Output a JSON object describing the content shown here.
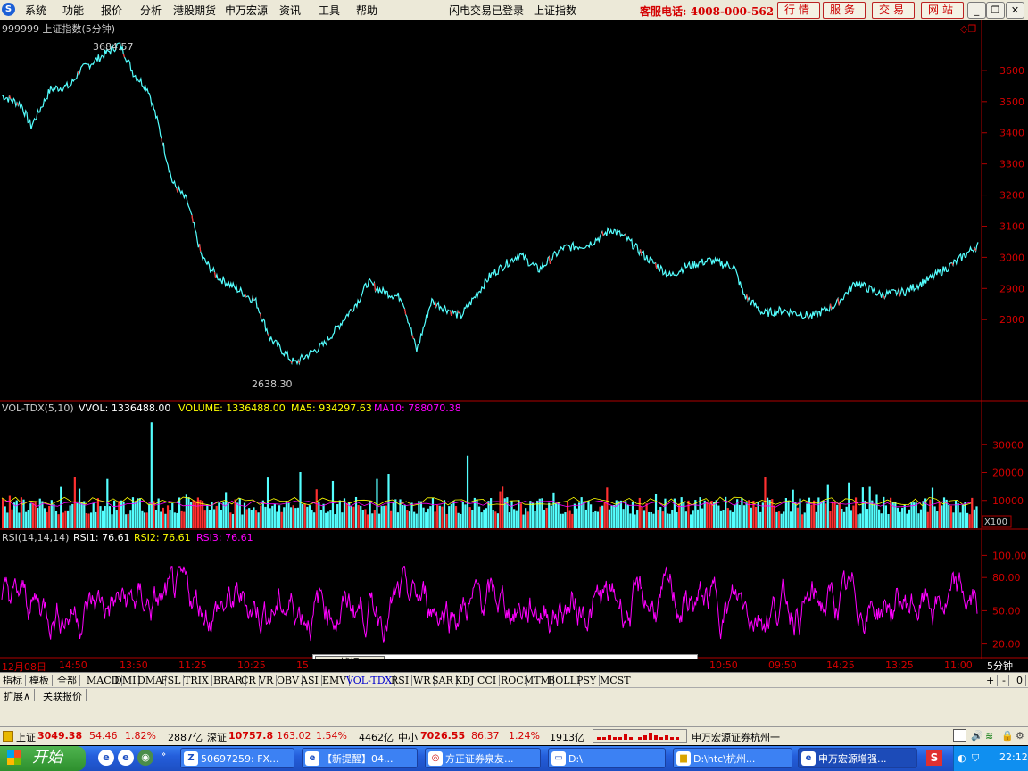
{
  "menubar": {
    "logo": "S",
    "items": [
      "系统",
      "功能",
      "报价",
      "分析",
      "港股期货",
      "申万宏源",
      "资讯",
      "工具",
      "帮助"
    ],
    "login_status": "闪电交易已登录",
    "index_name": "上证指数",
    "hotline": "客服电话: 4008-000-562",
    "tool_buttons": [
      "行情",
      "服务",
      "交易",
      "网站"
    ]
  },
  "chart_data": [
    {
      "type": "line",
      "title": "999999 上证指数(5分钟)",
      "ylim": [
        2560,
        3700
      ],
      "y_ticks": [
        2800,
        2900,
        3000,
        3100,
        3200,
        3300,
        3400,
        3500,
        3600
      ],
      "annotations": [
        {
          "text": "3684.57"
        },
        {
          "text": "2638.30"
        }
      ],
      "series": [
        {
          "name": "上证指数",
          "x_frac": [
            0,
            0.02,
            0.03,
            0.05,
            0.07,
            0.08,
            0.1,
            0.12,
            0.125,
            0.135,
            0.15,
            0.16,
            0.175,
            0.19,
            0.205,
            0.22,
            0.24,
            0.26,
            0.275,
            0.3,
            0.33,
            0.35,
            0.365,
            0.375,
            0.39,
            0.41,
            0.425,
            0.44,
            0.47,
            0.5,
            0.53,
            0.55,
            0.575,
            0.6,
            0.625,
            0.64,
            0.66,
            0.685,
            0.7,
            0.725,
            0.75,
            0.76,
            0.78,
            0.8,
            0.83,
            0.855,
            0.875,
            0.9,
            0.925,
            0.95,
            0.975,
            1.0
          ],
          "values": [
            3520,
            3490,
            3420,
            3540,
            3550,
            3600,
            3640,
            3684,
            3660,
            3590,
            3540,
            3430,
            3240,
            3180,
            3000,
            2940,
            2900,
            2860,
            2740,
            2660,
            2720,
            2800,
            2860,
            2920,
            2890,
            2870,
            2700,
            2860,
            2810,
            2940,
            3010,
            2960,
            3030,
            3040,
            3090,
            3060,
            3000,
            2940,
            2970,
            2990,
            2970,
            2880,
            2820,
            2830,
            2810,
            2850,
            2920,
            2880,
            2890,
            2930,
            2980,
            3040
          ]
        }
      ]
    },
    {
      "type": "bar",
      "title": "VOL-TDX(5,10)",
      "legend": [
        {
          "label": "VVOL: 1336488.00",
          "color": "#ffffff"
        },
        {
          "label": "VOLUME: 1336488.00",
          "color": "#ffff00"
        },
        {
          "label": "MA5: 934297.63",
          "color": "#ffff00"
        },
        {
          "label": "MA10: 788070.38",
          "color": "#ff00ff"
        }
      ],
      "ylim": [
        0,
        40000
      ],
      "y_ticks": [
        10000,
        20000,
        30000
      ],
      "unit": "X100",
      "typical_value": 9000
    },
    {
      "type": "line",
      "title": "RSI(14,14,14)",
      "legend": [
        {
          "label": "RSI1: 76.61",
          "color": "#ffffff"
        },
        {
          "label": "RSI2: 76.61",
          "color": "#ffff00"
        },
        {
          "label": "RSI3: 76.61",
          "color": "#ff00ff"
        }
      ],
      "ylim": [
        10,
        110
      ],
      "y_ticks": [
        "20.00",
        "50.00",
        "80.00",
        "100.00"
      ]
    }
  ],
  "timeaxis": {
    "labels": [
      "12月08日",
      "14:50",
      "13:50",
      "11:25",
      "10:25",
      "15",
      "10:50",
      "09:50",
      "14:25",
      "13:25",
      "11:00"
    ],
    "period": "5分钟"
  },
  "popup_button": "捕捉",
  "indicator_tabs": [
    "指标",
    "模板",
    "全部"
  ],
  "indicators": [
    "MACD",
    "DMI",
    "DMA",
    "FSL",
    "TRIX",
    "BRAR",
    "CR",
    "VR",
    "OBV",
    "ASI",
    "EMV",
    "VOL-TDX",
    "RSI",
    "WR",
    "SAR",
    "KDJ",
    "CCI",
    "ROC",
    "MTM",
    "BOLL",
    "PSY",
    "MCST"
  ],
  "active_indicator": "VOL-TDX",
  "nav_buttons": [
    "+",
    "-",
    "0"
  ],
  "ext_tabs": [
    "扩展∧",
    "关联报价"
  ],
  "ticker": {
    "sh_label": "上证",
    "sh_value": "3049.38",
    "sh_change": "54.46",
    "sh_pct": "1.82%",
    "sh_amount": "2887亿",
    "sz_label": "深证",
    "sz_value": "10757.8",
    "sz_change": "163.02",
    "sz_pct": "1.54%",
    "sz_amount": "4462亿",
    "zx_label": "中小",
    "zx_value": "7026.55",
    "zx_change": "86.37",
    "zx_pct": "1.24%",
    "zx_amount": "1913亿",
    "broker": "申万宏源证券杭州一"
  },
  "taskbar": {
    "start_label": "开始",
    "tasks": [
      "50697259: FX...",
      "【新提醒】04...",
      "方正证券泉友...",
      "D:\\",
      "D:\\htc\\杭州...",
      "申万宏源增强..."
    ],
    "clock": "22:12"
  }
}
